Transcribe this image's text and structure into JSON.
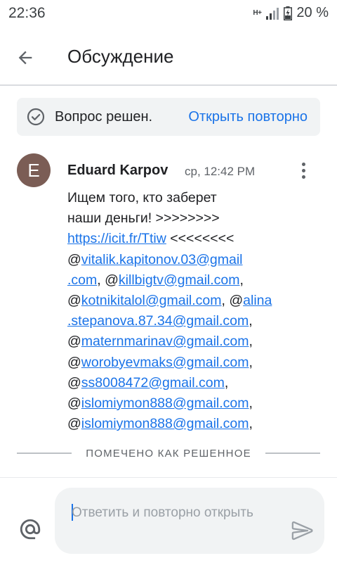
{
  "status_bar": {
    "time": "22:36",
    "network": "H+",
    "battery_percent": "20 %"
  },
  "app_bar": {
    "title": "Обсуждение"
  },
  "banner": {
    "text": "Вопрос решен.",
    "action": "Открыть повторно"
  },
  "post": {
    "avatar_letter": "E",
    "author": "Eduard Karpov",
    "time": "ср, 12:42 PM",
    "lines": [
      [
        {
          "t": "Ищем того, кто заберет"
        }
      ],
      [
        {
          "t": "наши деньги! >>>>>>>>"
        }
      ],
      [
        {
          "t": "https://icit.fr/Ttiw",
          "link": true
        },
        {
          "t": " <<<<<<<<"
        }
      ],
      [
        {
          "t": "@"
        },
        {
          "t": "vitalik.kapitonov.03@gmail",
          "link": true
        }
      ],
      [
        {
          "t": ".com",
          "link": true
        },
        {
          "t": ", @"
        },
        {
          "t": "killbigtv@gmail.com",
          "link": true
        },
        {
          "t": ","
        }
      ],
      [
        {
          "t": "@"
        },
        {
          "t": "kotnikitalol@gmail.com",
          "link": true
        },
        {
          "t": ", @"
        },
        {
          "t": "alina",
          "link": true
        }
      ],
      [
        {
          "t": ".stepanova.87.34@gmail.com",
          "link": true
        },
        {
          "t": ","
        }
      ],
      [
        {
          "t": "@"
        },
        {
          "t": "maternmarinav@gmail.com",
          "link": true
        },
        {
          "t": ","
        }
      ],
      [
        {
          "t": "@"
        },
        {
          "t": "worobyevmaks@gmail.com",
          "link": true
        },
        {
          "t": ","
        }
      ],
      [
        {
          "t": "@"
        },
        {
          "t": "ss8008472@gmail.com",
          "link": true
        },
        {
          "t": ","
        }
      ],
      [
        {
          "t": "@"
        },
        {
          "t": "islomiymon888@gmail.com",
          "link": true
        },
        {
          "t": ","
        }
      ],
      [
        {
          "t": "@"
        },
        {
          "t": "islomiymon888@gmail.com",
          "link": true
        },
        {
          "t": ","
        }
      ]
    ]
  },
  "marker": {
    "label": "ПОМЕЧЕНО КАК РЕШЕННОЕ"
  },
  "composer": {
    "placeholder": "Ответить и повторно открыть"
  },
  "icons": {
    "back": "arrow-back-icon",
    "check": "check-circle-icon",
    "more": "more-vert-icon",
    "mention": "at-sign-icon",
    "send": "send-icon"
  },
  "colors": {
    "accent": "#1a73e8",
    "avatar": "#7b5d55",
    "banner_bg": "#f1f3f4"
  }
}
